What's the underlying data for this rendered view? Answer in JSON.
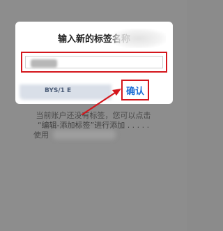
{
  "dialog": {
    "title": "输入新的标签名称",
    "input": {
      "value": "",
      "placeholder": ""
    },
    "footer_text": "BYS/1 E",
    "confirm_label": "确认"
  },
  "background": {
    "line1": "当前账户还没有标签，您可以点击",
    "line2": "“编辑-添加标签”进行添加 . . . . .",
    "line3": "使用"
  },
  "annotation": {
    "highlight_color": "#d4161c",
    "arrow_target": "confirm-button"
  }
}
